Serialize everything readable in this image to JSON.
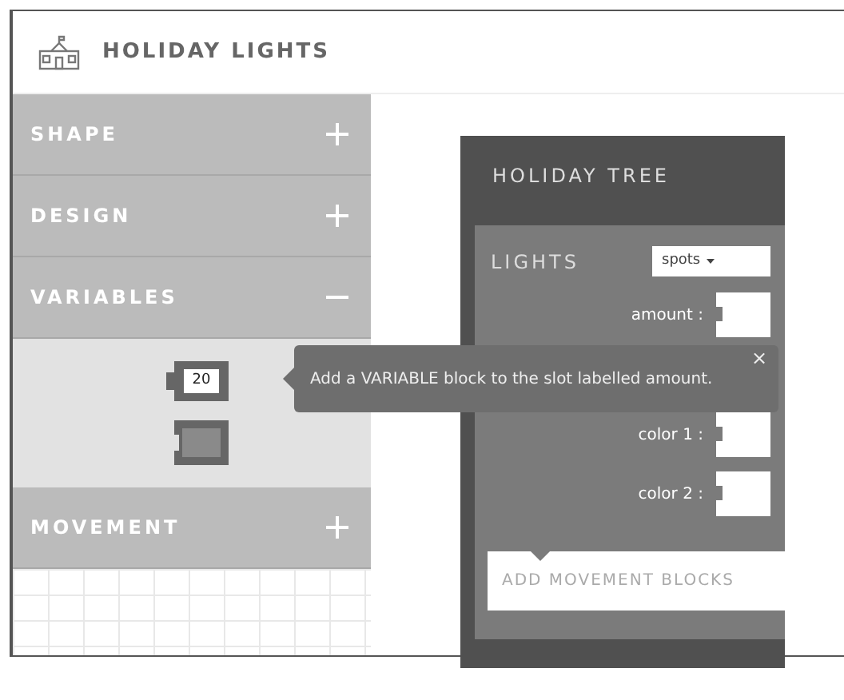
{
  "app": {
    "title": "HOLIDAY LIGHTS"
  },
  "sidebar": {
    "sections": [
      {
        "label": "SHAPE",
        "expanded": false
      },
      {
        "label": "DESIGN",
        "expanded": false
      },
      {
        "label": "VARIABLES",
        "expanded": true,
        "blocks": [
          {
            "kind": "number",
            "value": "20"
          },
          {
            "kind": "color"
          }
        ]
      },
      {
        "label": "MOVEMENT",
        "expanded": false
      }
    ]
  },
  "tree_block": {
    "title": "HOLIDAY TREE",
    "lights": {
      "label": "LIGHTS",
      "dropdown": "spots",
      "slots": [
        {
          "label": "amount :"
        },
        {
          "label": "color 1 :"
        },
        {
          "label": "color 2 :"
        }
      ]
    },
    "movement_placeholder": "ADD MOVEMENT BLOCKS"
  },
  "tooltip": {
    "text": "Add a VARIABLE block to the slot labelled amount.",
    "close": "×"
  }
}
